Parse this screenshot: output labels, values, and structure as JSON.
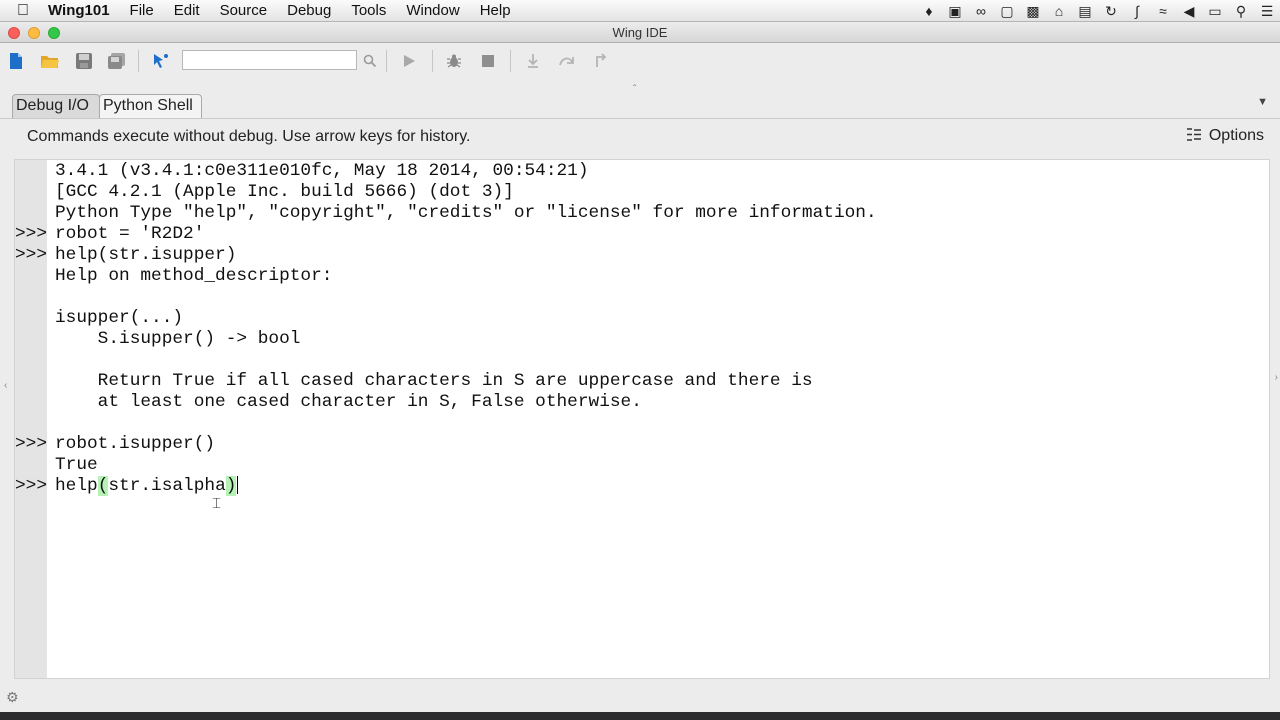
{
  "menubar": {
    "app_name": "Wing101",
    "items": [
      "File",
      "Edit",
      "Source",
      "Debug",
      "Tools",
      "Window",
      "Help"
    ],
    "status_icons": [
      "bell-icon",
      "display-icon",
      "glasses-icon",
      "window-icon",
      "camera-icon",
      "home-icon",
      "battery-meter-icon",
      "time-machine-icon",
      "bluetooth-icon",
      "wifi-icon",
      "volume-icon",
      "battery-icon",
      "spotlight-icon",
      "list-icon"
    ]
  },
  "window": {
    "title": "Wing IDE"
  },
  "toolbar": {
    "search_placeholder": "",
    "buttons": [
      "new-file-icon",
      "open-folder-icon",
      "save-icon",
      "save-all-icon",
      "select-tool-icon",
      "search-icon",
      "run-icon",
      "debug-icon",
      "stop-icon",
      "step-into-icon",
      "step-over-icon",
      "step-out-icon"
    ]
  },
  "tabs": [
    {
      "label": "Debug I/O",
      "active": false
    },
    {
      "label": "Python Shell",
      "active": true
    }
  ],
  "info": {
    "text": "Commands execute without debug.  Use arrow keys for history.",
    "options_label": "Options"
  },
  "shell": {
    "lines": [
      {
        "prompt": "",
        "text": "3.4.1 (v3.4.1:c0e311e010fc, May 18 2014, 00:54:21)"
      },
      {
        "prompt": "",
        "text": "[GCC 4.2.1 (Apple Inc. build 5666) (dot 3)]"
      },
      {
        "prompt": "",
        "text": "Python Type \"help\", \"copyright\", \"credits\" or \"license\" for more information."
      },
      {
        "prompt": ">>>",
        "text": "robot = 'R2D2'"
      },
      {
        "prompt": ">>>",
        "text": "help(str.isupper)"
      },
      {
        "prompt": "",
        "text": "Help on method_descriptor:"
      },
      {
        "prompt": "",
        "text": ""
      },
      {
        "prompt": "",
        "text": "isupper(...)"
      },
      {
        "prompt": "",
        "text": "    S.isupper() -> bool"
      },
      {
        "prompt": "",
        "text": ""
      },
      {
        "prompt": "",
        "text": "    Return True if all cased characters in S are uppercase and there is"
      },
      {
        "prompt": "",
        "text": "    at least one cased character in S, False otherwise."
      },
      {
        "prompt": "",
        "text": ""
      },
      {
        "prompt": ">>>",
        "text": "robot.isupper()"
      },
      {
        "prompt": "",
        "text": "True"
      }
    ],
    "current_prompt": ">>>",
    "current_input": {
      "before": "help",
      "open_paren": "(",
      "middle": "str.isalpha",
      "close_paren": ")"
    }
  }
}
